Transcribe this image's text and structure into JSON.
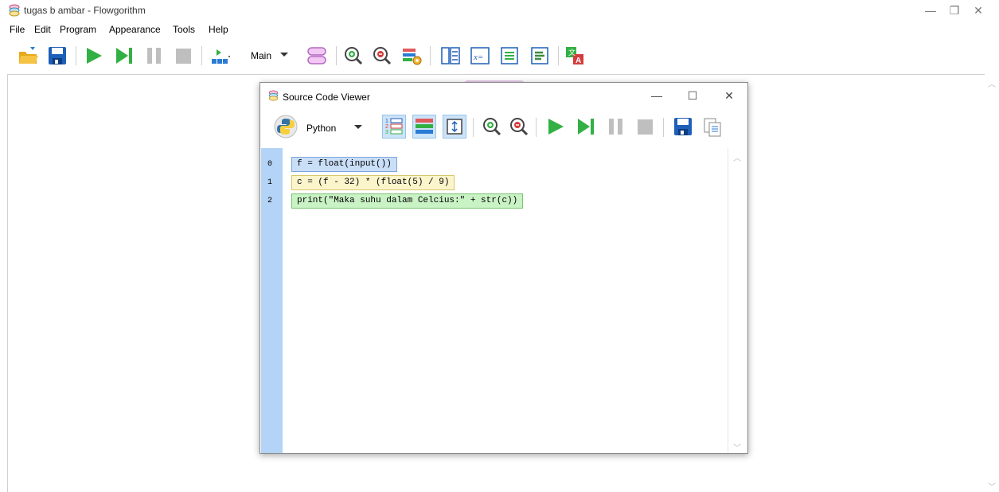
{
  "window": {
    "title": "tugas b ambar - Flowgorithm",
    "minimize_glyph": "—",
    "maximize_glyph": "❐",
    "close_glyph": "✕"
  },
  "menu": {
    "items": [
      "File",
      "Edit",
      "Program",
      "Appearance",
      "Tools",
      "Help"
    ]
  },
  "toolbar": {
    "function_select": "Main",
    "icons": [
      "open-folder-icon",
      "save-icon",
      "run-icon",
      "step-icon",
      "pause-icon",
      "stop-icon",
      "layout-icon",
      "add-function-icon",
      "zoom-in-icon",
      "zoom-out-icon",
      "settings-icon",
      "variable-watch-icon",
      "console-icon",
      "source-code-icon",
      "chart-icon",
      "translate-icon"
    ]
  },
  "source_viewer": {
    "title": "Source Code Viewer",
    "language": "Python",
    "minimize_glyph": "—",
    "maximize_glyph": "☐",
    "close_glyph": "✕",
    "lines": [
      {
        "number": "0",
        "code": "f = float(input())",
        "kind": "blue"
      },
      {
        "number": "1",
        "code": "c = (f - 32) * (float(5) / 9)",
        "kind": "yellow"
      },
      {
        "number": "2",
        "code": "print(\"Maka suhu dalam Celcius:\" + str(c))",
        "kind": "green"
      }
    ]
  },
  "colors": {
    "accent_green": "#33b044",
    "gutter": "#b3d3f7",
    "selected_tool": "#cde3f7"
  }
}
